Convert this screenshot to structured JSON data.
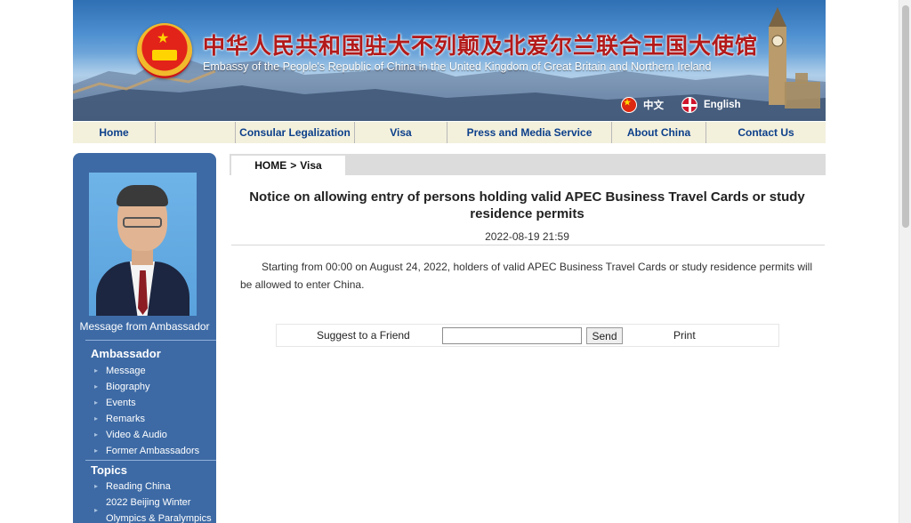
{
  "banner": {
    "title_cn": "中华人民共和国驻大不列颠及北爱尔兰联合王国大使馆",
    "title_en": "Embassy of the People's Republic of China in the United Kingdom of Great Britain and Northern Ireland",
    "languages": [
      {
        "label": "中文",
        "icon": "china-flag-icon"
      },
      {
        "label": "English",
        "icon": "uk-flag-icon"
      }
    ]
  },
  "nav": {
    "items": [
      {
        "label": "Home"
      },
      {
        "label": ""
      },
      {
        "label": "Consular Legalization"
      },
      {
        "label": "Visa"
      },
      {
        "label": "Press and Media Service"
      },
      {
        "label": "About China"
      },
      {
        "label": "Contact Us"
      }
    ]
  },
  "sidebar": {
    "message_label": "Message from Ambassador",
    "sections": [
      {
        "heading": "Ambassador",
        "items": [
          "Message",
          "Biography",
          "Events",
          "Remarks",
          "Video & Audio",
          "Former Ambassadors"
        ]
      },
      {
        "heading": "Topics",
        "items": [
          "Reading China",
          "2022 Beijing Winter",
          "Olympics & Paralympics"
        ]
      }
    ]
  },
  "breadcrumb": {
    "home": "HOME",
    "separator": ">",
    "current": "Visa"
  },
  "article": {
    "title": "Notice on allowing entry of persons holding valid APEC Business Travel Cards or study residence permits",
    "date": "2022-08-19 21:59",
    "body": "Starting from 00:00 on August 24, 2022, holders of valid APEC Business Travel Cards or study residence permits will be allowed to enter China."
  },
  "share": {
    "suggest_label": "Suggest to a Friend",
    "input_value": "",
    "send_label": "Send",
    "print_label": "Print"
  },
  "colors": {
    "nav_text": "#0c3f8a",
    "nav_bg": "#f3f0dc",
    "sidebar_bg": "#3d6aa5",
    "title_cn": "#b31a1a"
  }
}
